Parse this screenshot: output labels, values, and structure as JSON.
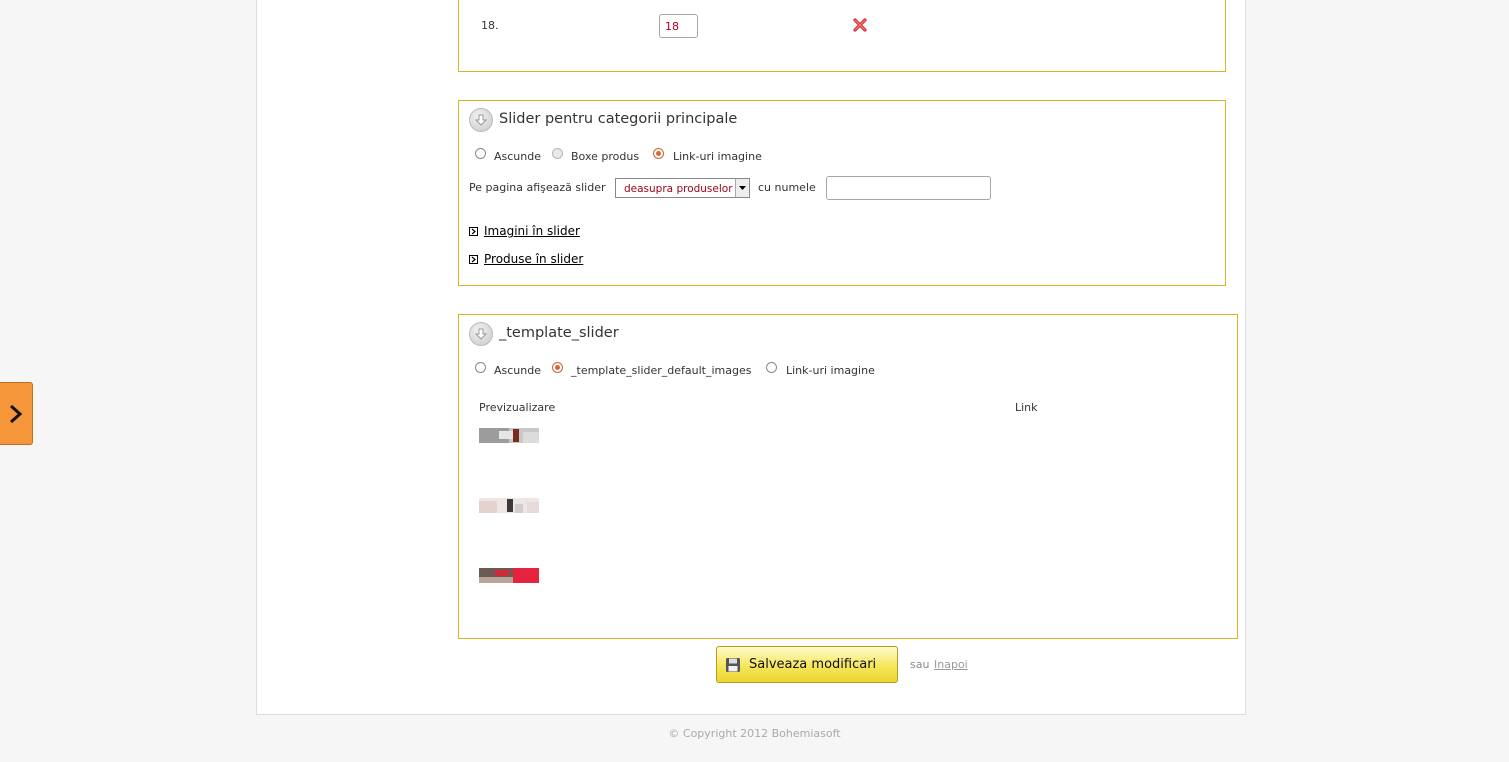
{
  "row": {
    "number": "18.",
    "quantity": "18"
  },
  "section1": {
    "title": "Slider pentru categorii principale",
    "options": [
      "Ascunde",
      "Boxe produs",
      "Link-uri imagine"
    ],
    "selected": "Link-uri imagine",
    "page_label": "Pe pagina afişează slider",
    "position_value": "deasupra produselor",
    "name_label": "cu numele",
    "name_value": "",
    "links": [
      "Imagini în slider",
      "Produse în slider"
    ]
  },
  "section2": {
    "title": "_template_slider",
    "options": [
      "Ascunde",
      "_template_slider_default_images",
      "Link-uri imagine"
    ],
    "selected": "_template_slider_default_images",
    "columns": {
      "preview": "Previzualizare",
      "link": "Link"
    }
  },
  "actions": {
    "save": "Salveaza modificari",
    "or": "sau",
    "back": "Inapoi"
  },
  "footer": {
    "copyright": "© Copyright 2012 Bohemiasoft"
  },
  "colors": {
    "accent_border": "#d4b726",
    "side_tab": "#f5963a",
    "save_button": "#f5e65a"
  },
  "icons": [
    "delete-icon",
    "collapse-arrow-icon",
    "expand-box-icon",
    "floppy-disk-icon",
    "chevron-right-icon"
  ]
}
